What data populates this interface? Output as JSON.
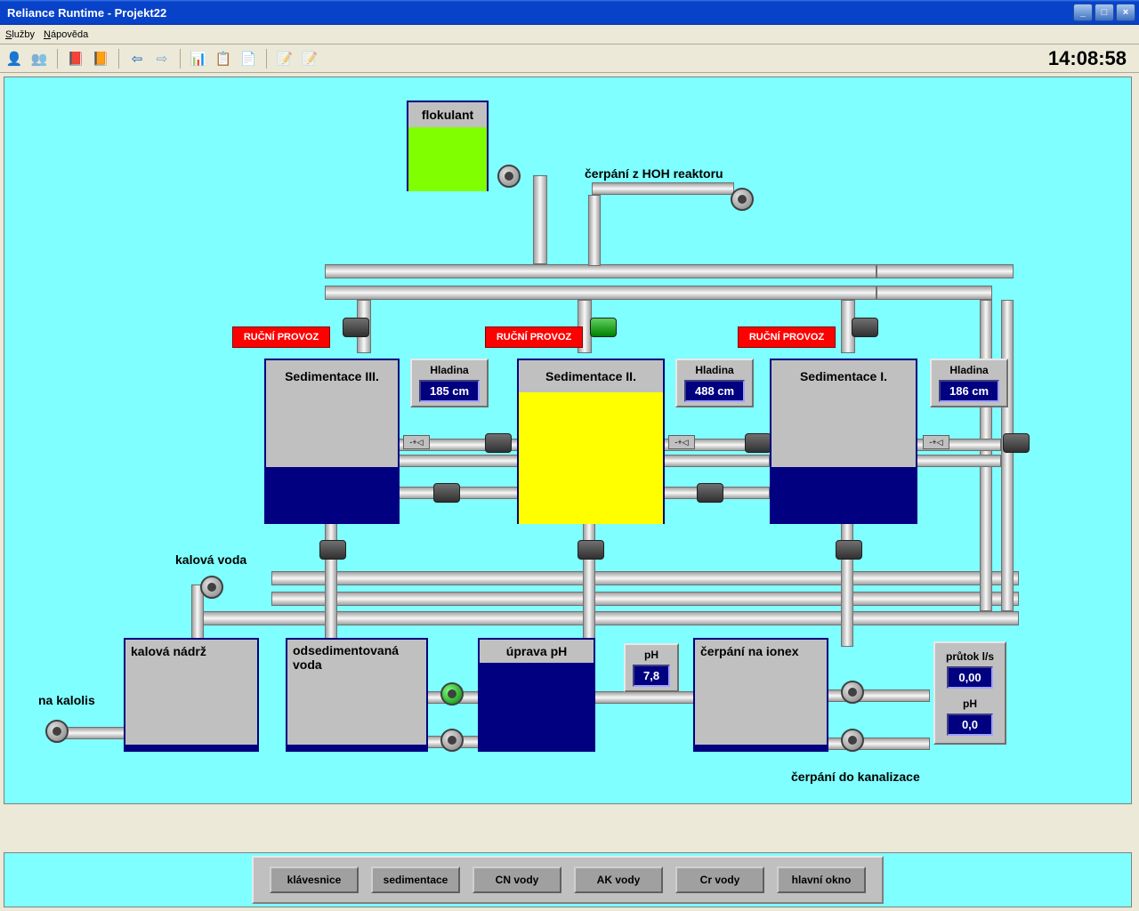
{
  "title": "Reliance Runtime  - Projekt22",
  "menu": {
    "services": "Služby",
    "help": "Nápověda"
  },
  "clock": "14:08:58",
  "flokulant": {
    "label": "flokulant"
  },
  "labels": {
    "hoh": "čerpání z HOH reaktoru",
    "kalova_voda": "kalová voda",
    "kalova_nadrz": "kalová nádrž",
    "na_kalolis": "na kalolis",
    "odsed_voda": "odsedimentovaná voda",
    "uprava_ph": "úprava pH",
    "cerpani_ionex": "čerpání na ionex",
    "cerpani_kanal": "čerpání do kanalizace"
  },
  "sed1": {
    "title": "Sedimentace I.",
    "status": "RUČNÍ PROVOZ",
    "hladina_label": "Hladina",
    "hladina_value": "186 cm"
  },
  "sed2": {
    "title": "Sedimentace II.",
    "status": "RUČNÍ PROVOZ",
    "hladina_label": "Hladina",
    "hladina_value": "488 cm"
  },
  "sed3": {
    "title": "Sedimentace III.",
    "status": "RUČNÍ PROVOZ",
    "hladina_label": "Hladina",
    "hladina_value": "185 cm"
  },
  "ph_small": {
    "label": "pH",
    "value": "7,8"
  },
  "prutok": {
    "label": "průtok l/s",
    "value": "0,00"
  },
  "ph_right": {
    "label": "pH",
    "value": "0,0"
  },
  "buttons": {
    "klavesnice": "klávesnice",
    "sedimentace": "sedimentace",
    "cn": "CN vody",
    "ak": "AK vody",
    "cr": "Cr vody",
    "hlavni": "hlavní okno"
  }
}
